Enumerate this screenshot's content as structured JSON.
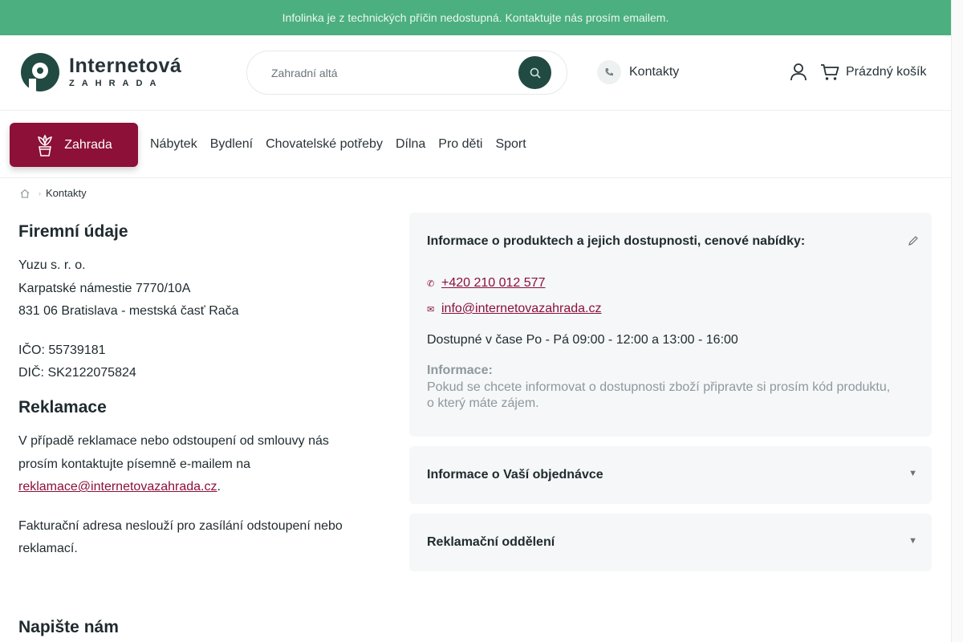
{
  "topbar": {
    "text": "Infolinka je z technických příčin nedostupná. Kontaktujte nás prosím emailem."
  },
  "logo": {
    "line1": "Internetová",
    "line2": "ZAHRADA"
  },
  "search": {
    "placeholder": "Zahradní altá"
  },
  "header": {
    "contacts_label": "Kontakty",
    "cart_label": "Prázdný košík"
  },
  "nav": {
    "main_label": "Zahrada",
    "items": [
      "Nábytek",
      "Bydlení",
      "Chovatelské potřeby",
      "Dílna",
      "Pro děti",
      "Sport"
    ]
  },
  "breadcrumb": {
    "current": "Kontakty"
  },
  "company": {
    "title": "Firemní údaje",
    "name": "Yuzu s. r. o.",
    "street": "Karpatské námestie 7770/10A",
    "city": "831 06 Bratislava - mestská časť Rača",
    "ico": "IČO: 55739181",
    "dic": "DIČ: SK2122075824"
  },
  "claims": {
    "title": "Reklamace",
    "text_before": "V případě reklamace nebo odstoupení od smlouvy nás prosím kontaktujte písemně e-mailem na",
    "email": "reklamace@internetovazahrada.cz",
    "text_after": ".",
    "note": "Fakturační adresa neslouží pro zasílání odstoupení nebo reklamací."
  },
  "info_card": {
    "title": "Informace o produktech a jejich dostupnosti, cenové nabídky:",
    "phone": "+420 210 012 577",
    "email": "info@internetovazahrada.cz",
    "hours": "Dostupné v čase Po - Pá 09:00 - 12:00 a 13:00 - 16:00",
    "note_label": "Informace:",
    "note_text": "Pokud se chcete informovat o dostupnosti zboží připravte si prosím kód produktu, o který máte zájem."
  },
  "order_card": {
    "title": "Informace o Vaší objednávce"
  },
  "claims_card": {
    "title": "Reklamační oddělení"
  },
  "write": {
    "title": "Napište nám"
  },
  "colors": {
    "brand_green": "#4caf7f",
    "brand_dark": "#214a42",
    "accent": "#8c1038"
  }
}
